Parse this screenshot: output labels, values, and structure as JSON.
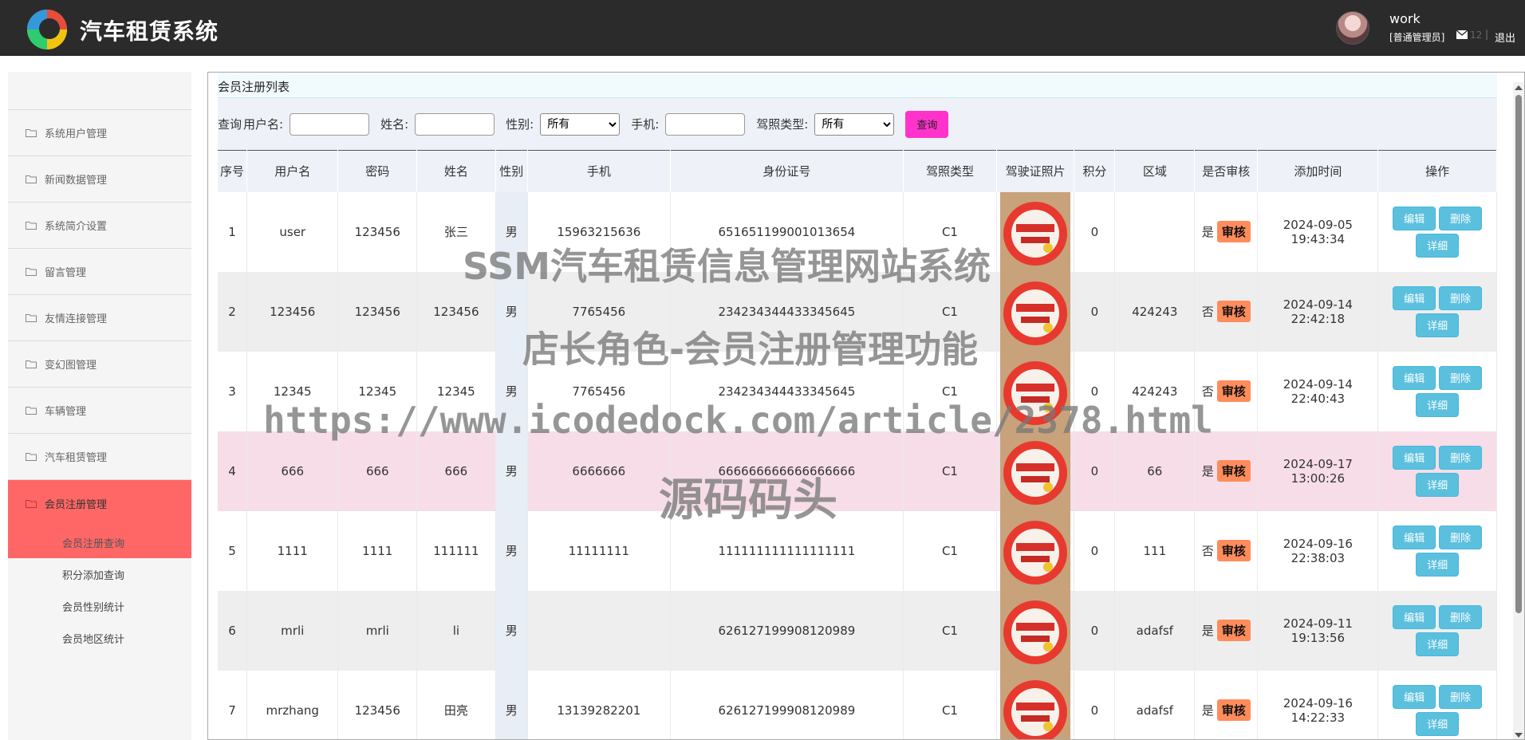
{
  "header": {
    "app_title": "汽车租赁系统",
    "username": "work",
    "role": "[普通管理员]",
    "message_count": "12",
    "separator": "|",
    "logout_label": "退出"
  },
  "sidebar": {
    "items": [
      {
        "label": "系统用户管理"
      },
      {
        "label": "新闻数据管理"
      },
      {
        "label": "系统简介设置"
      },
      {
        "label": "留言管理"
      },
      {
        "label": "友情连接管理"
      },
      {
        "label": "变幻图管理"
      },
      {
        "label": "车辆管理"
      },
      {
        "label": "汽车租赁管理"
      },
      {
        "label": "会员注册管理"
      }
    ],
    "subitems": [
      {
        "label": "会员注册查询"
      },
      {
        "label": "积分添加查询"
      },
      {
        "label": "会员性别统计"
      },
      {
        "label": "会员地区统计"
      }
    ]
  },
  "panel": {
    "title": "会员注册列表"
  },
  "search": {
    "query_label": "查询",
    "username_label": "用户名:",
    "name_label": "姓名:",
    "gender_label": "性别:",
    "gender_value": "所有",
    "phone_label": "手机:",
    "license_label": "驾照类型:",
    "license_value": "所有",
    "query_button": "查询"
  },
  "table": {
    "headers": [
      "序号",
      "用户名",
      "密码",
      "姓名",
      "性别",
      "手机",
      "身份证号",
      "驾照类型",
      "驾驶证照片",
      "积分",
      "区域",
      "是否审核",
      "添加时间",
      "操作"
    ],
    "audit_button": "审核",
    "edit_button": "编辑",
    "delete_button": "删除",
    "detail_button": "详细",
    "rows": [
      {
        "no": "1",
        "username": "user",
        "password": "123456",
        "name": "张三",
        "sex": "男",
        "phone": "15963215636",
        "id_card": "651651199001013654",
        "license": "C1",
        "points": "0",
        "region": "",
        "audited": "是",
        "time": "2024-09-05 19:43:34"
      },
      {
        "no": "2",
        "username": "123456",
        "password": "123456",
        "name": "123456",
        "sex": "男",
        "phone": "7765456",
        "id_card": "234234344433345645",
        "license": "C1",
        "points": "0",
        "region": "424243",
        "audited": "否",
        "time": "2024-09-14 22:42:18"
      },
      {
        "no": "3",
        "username": "12345",
        "password": "12345",
        "name": "12345",
        "sex": "男",
        "phone": "7765456",
        "id_card": "234234344433345645",
        "license": "C1",
        "points": "0",
        "region": "424243",
        "audited": "否",
        "time": "2024-09-14 22:40:43"
      },
      {
        "no": "4",
        "username": "666",
        "password": "666",
        "name": "666",
        "sex": "男",
        "phone": "6666666",
        "id_card": "666666666666666666",
        "license": "C1",
        "points": "0",
        "region": "66",
        "audited": "是",
        "time": "2024-09-17 13:00:26"
      },
      {
        "no": "5",
        "username": "1111",
        "password": "1111",
        "name": "111111",
        "sex": "男",
        "phone": "11111111",
        "id_card": "111111111111111111",
        "license": "C1",
        "points": "0",
        "region": "111",
        "audited": "否",
        "time": "2024-09-16 22:38:03"
      },
      {
        "no": "6",
        "username": "mrli",
        "password": "mrli",
        "name": "li",
        "sex": "男",
        "phone": "",
        "id_card": "626127199908120989",
        "license": "C1",
        "points": "0",
        "region": "adafsf",
        "audited": "是",
        "time": "2024-09-11 19:13:56"
      },
      {
        "no": "7",
        "username": "mrzhang",
        "password": "123456",
        "name": "田亮",
        "sex": "男",
        "phone": "13139282201",
        "id_card": "626127199908120989",
        "license": "C1",
        "points": "0",
        "region": "adafsf",
        "audited": "是",
        "time": "2024-09-16 14:22:33"
      }
    ]
  },
  "watermark": {
    "line1": "SSM汽车租赁信息管理网站系统",
    "line2": "店长角色-会员注册管理功能",
    "line3": "https://www.icodedock.com/article/2378.html",
    "line4": "源码码头"
  },
  "colors": {
    "header_bg": "#2b2b2b",
    "sidebar_active": "#ff6666",
    "query_button": "#ff33cc",
    "audit_button": "#ff8c5a",
    "op_button": "#5bc0de",
    "row_highlight": "#f7dde8"
  }
}
